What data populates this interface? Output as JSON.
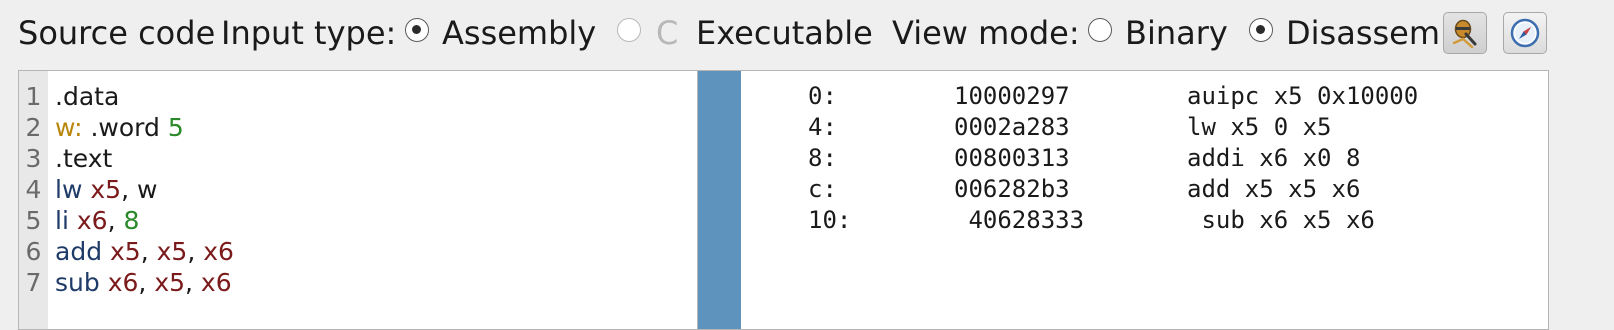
{
  "toolbar": {
    "source_code_label": "Source code",
    "input_type_label": "Input type:",
    "options_input": {
      "assembly": "Assembly",
      "c": "C",
      "executable": "Executable",
      "selected": "Assembly"
    },
    "view_mode_label": "View mode:",
    "options_view": {
      "binary": "Binary",
      "disassembly": "Disassembly",
      "selected": "Disassembly"
    },
    "icons": [
      "debug-icon",
      "compass-icon"
    ]
  },
  "editor": {
    "lines": [
      {
        "num": "1",
        "tokens": [
          {
            "t": ".data",
            "k": "plain"
          }
        ]
      },
      {
        "num": "2",
        "tokens": [
          {
            "t": "w:",
            "k": "label"
          },
          {
            "t": " .word ",
            "k": "plain"
          },
          {
            "t": "5",
            "k": "num"
          }
        ]
      },
      {
        "num": "3",
        "tokens": [
          {
            "t": ".text",
            "k": "plain"
          }
        ]
      },
      {
        "num": "4",
        "tokens": [
          {
            "t": "lw",
            "k": "op"
          },
          {
            "t": " ",
            "k": "plain"
          },
          {
            "t": "x5",
            "k": "reg"
          },
          {
            "t": ", w",
            "k": "plain"
          }
        ]
      },
      {
        "num": "5",
        "tokens": [
          {
            "t": "li",
            "k": "op"
          },
          {
            "t": " ",
            "k": "plain"
          },
          {
            "t": "x6",
            "k": "reg"
          },
          {
            "t": ", ",
            "k": "plain"
          },
          {
            "t": "8",
            "k": "num"
          }
        ]
      },
      {
        "num": "6",
        "tokens": [
          {
            "t": "add",
            "k": "op"
          },
          {
            "t": " ",
            "k": "plain"
          },
          {
            "t": "x5",
            "k": "reg"
          },
          {
            "t": ", ",
            "k": "plain"
          },
          {
            "t": "x5",
            "k": "reg"
          },
          {
            "t": ", ",
            "k": "plain"
          },
          {
            "t": "x6",
            "k": "reg"
          }
        ]
      },
      {
        "num": "7",
        "tokens": [
          {
            "t": "sub",
            "k": "op"
          },
          {
            "t": " ",
            "k": "plain"
          },
          {
            "t": "x6",
            "k": "reg"
          },
          {
            "t": ", ",
            "k": "plain"
          },
          {
            "t": "x5",
            "k": "reg"
          },
          {
            "t": ", ",
            "k": "plain"
          },
          {
            "t": "x6",
            "k": "reg"
          }
        ]
      }
    ]
  },
  "disassembly": {
    "rows": [
      {
        "addr": "0:",
        "hex": "10000297",
        "inst": "auipc x5 0x10000"
      },
      {
        "addr": "4:",
        "hex": "0002a283",
        "inst": "lw x5 0 x5"
      },
      {
        "addr": "8:",
        "hex": "00800313",
        "inst": "addi x6 x0 8"
      },
      {
        "addr": "c:",
        "hex": "006282b3",
        "inst": "add x5 x5 x6"
      },
      {
        "addr": "10:",
        "hex": " 40628333",
        "inst": " sub x6 x5 x6"
      }
    ]
  },
  "colors": {
    "label": "#b8860b",
    "number": "#2a8a2a",
    "opcode": "#1f3b68",
    "register": "#7a1a1a",
    "disassembly_bar": "#5d93bc"
  }
}
